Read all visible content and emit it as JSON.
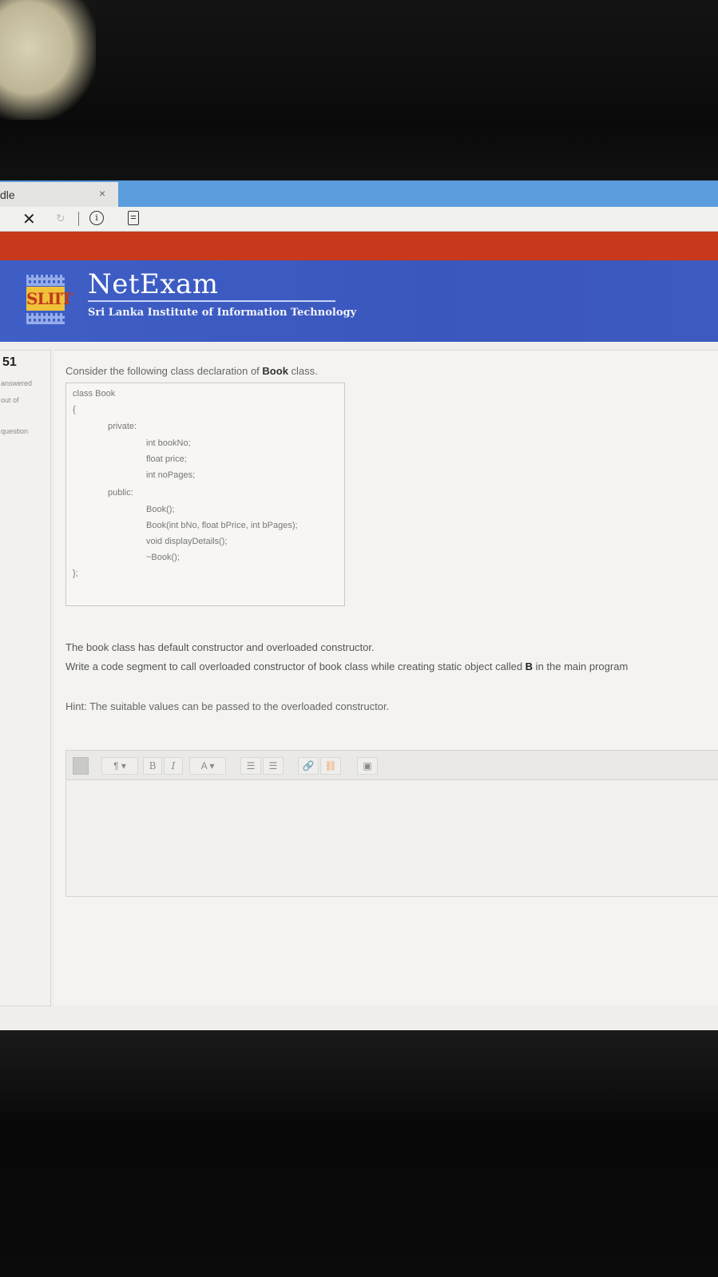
{
  "browser": {
    "tab_title": "dle",
    "tab_close": "×",
    "stop_glyph": "✕",
    "refresh_glyph": "↻",
    "info_glyph": "i"
  },
  "header": {
    "logo_text": "SLIIT",
    "brand_name": "NetExam",
    "brand_subtitle": "Sri Lanka Institute of Information Technology"
  },
  "question_info": {
    "number": "51",
    "status": "answered",
    "marks": "out of",
    "flag": "question"
  },
  "question": {
    "prompt_prefix": "Consider the following class declaration of ",
    "prompt_bold": "Book",
    "prompt_suffix": " class.",
    "code": {
      "line1": "class Book",
      "line2": "{",
      "line3": "private:",
      "line4": "int bookNo;",
      "line5": "float price;",
      "line6": "int noPages;",
      "line7": "public:",
      "line8": "Book();",
      "line9": "Book(int bNo, float bPrice, int bPages);",
      "line10": "void displayDetails();",
      "line11": "~Book();",
      "line12": "};"
    },
    "desc1": "The book class has default constructor and overloaded constructor.",
    "desc2_prefix": "Write a code segment to call overloaded constructor of book class while creating static object called ",
    "desc2_bold": "B",
    "desc2_suffix": " in the main program",
    "hint": "Hint: The suitable values can be passed to the overloaded constructor."
  },
  "editor": {
    "toolbar": {
      "toggle": "",
      "paragraph": "¶ ▾",
      "bold": "B",
      "italic": "I",
      "font": "A ▾",
      "bullets": "☰",
      "numbers": "☰",
      "link": "🔗",
      "unlink": "⛓",
      "image": "▣"
    },
    "content": ""
  }
}
